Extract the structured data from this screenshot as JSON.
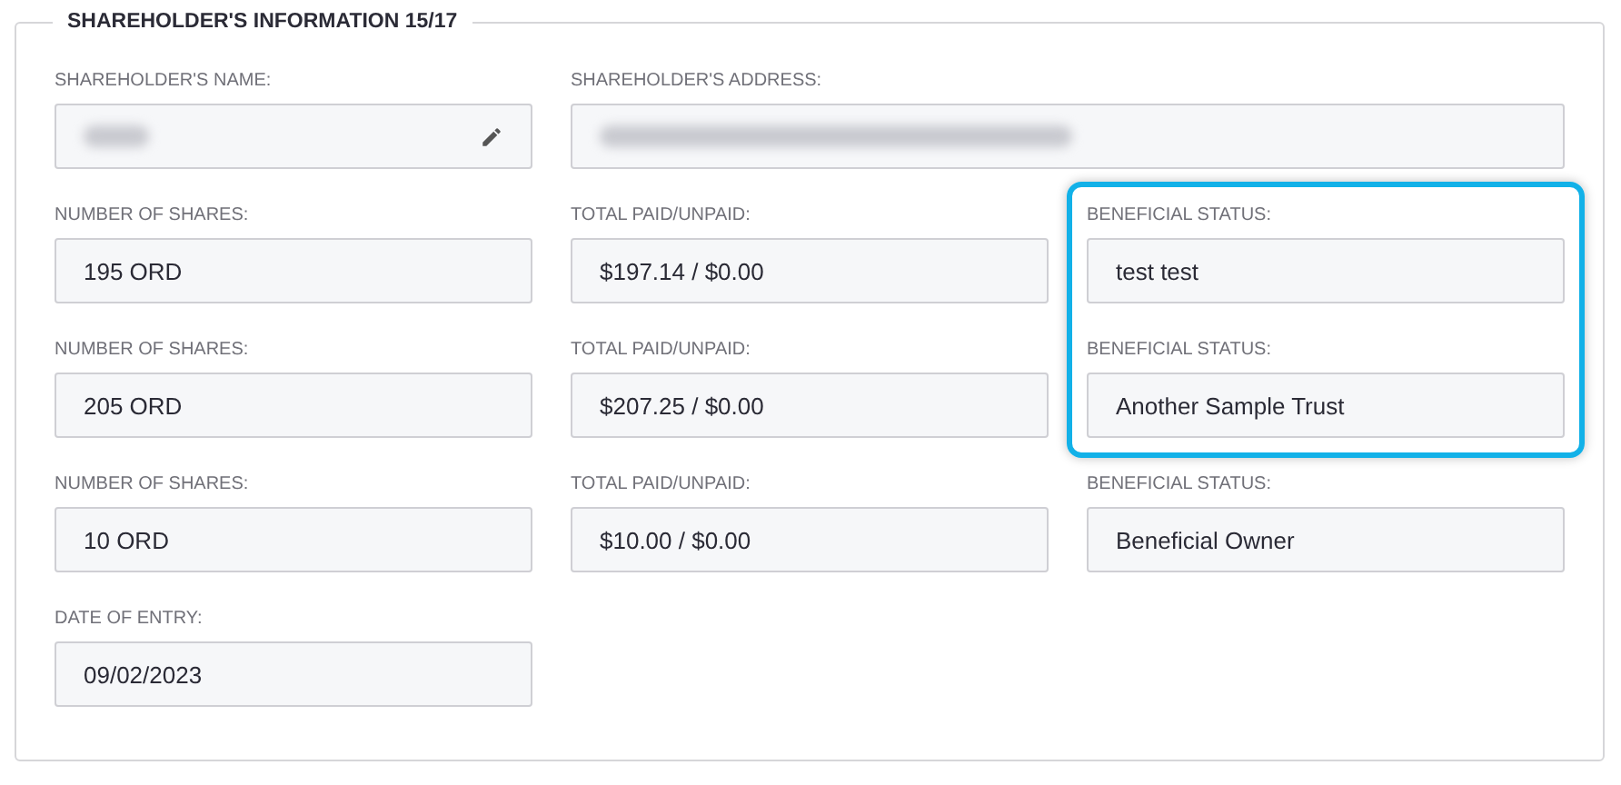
{
  "section": {
    "title": "SHAREHOLDER'S INFORMATION 15/17"
  },
  "name": {
    "label": "SHAREHOLDER'S NAME:",
    "redacted": true,
    "editable": true
  },
  "address": {
    "label": "SHAREHOLDER'S ADDRESS:",
    "redacted": true
  },
  "holdings": [
    {
      "shares_label": "NUMBER OF SHARES:",
      "shares": "195 ORD",
      "paid_label": "TOTAL PAID/UNPAID:",
      "paid": "$197.14 / $0.00",
      "status_label": "BENEFICIAL STATUS:",
      "status": "test test",
      "highlighted": true
    },
    {
      "shares_label": "NUMBER OF SHARES:",
      "shares": "205 ORD",
      "paid_label": "TOTAL PAID/UNPAID:",
      "paid": "$207.25 / $0.00",
      "status_label": "BENEFICIAL STATUS:",
      "status": "Another Sample Trust",
      "highlighted": true
    },
    {
      "shares_label": "NUMBER OF SHARES:",
      "shares": "10 ORD",
      "paid_label": "TOTAL PAID/UNPAID:",
      "paid": "$10.00 / $0.00",
      "status_label": "BENEFICIAL STATUS:",
      "status": "Beneficial Owner",
      "highlighted": false
    }
  ],
  "date_of_entry": {
    "label": "DATE OF ENTRY:",
    "value": "09/02/2023"
  }
}
